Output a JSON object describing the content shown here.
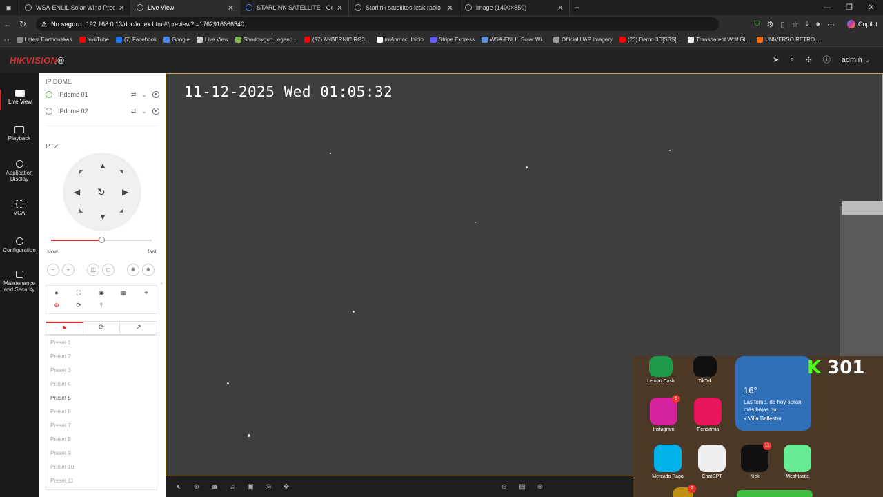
{
  "browser": {
    "tabs": [
      {
        "title": "WSA-ENLIL Solar Wind Predictio",
        "active": false
      },
      {
        "title": "Live View",
        "active": true
      },
      {
        "title": "STARLINK SATELLITE - Google Se",
        "active": false
      },
      {
        "title": "Starlink satellites leak radio signal",
        "active": false
      },
      {
        "title": "image (1400×850)",
        "active": false
      }
    ],
    "security_label": "No seguro",
    "url": "192.168.0.13/doc/index.html#/preview?t=1762916666540",
    "copilot_label": "Copilot",
    "bookmarks": [
      {
        "label": "Latest Earthquakes",
        "color": "#888888"
      },
      {
        "label": "YouTube",
        "color": "#ff0000"
      },
      {
        "label": "(7) Facebook",
        "color": "#1877f2"
      },
      {
        "label": "Google",
        "color": "#4285f4"
      },
      {
        "label": "Live View",
        "color": "#cccccc"
      },
      {
        "label": "Shadowgun Legend...",
        "color": "#7cb342"
      },
      {
        "label": "(97) ANBERNIC RG3...",
        "color": "#ff0000"
      },
      {
        "label": "miAnmac. Inicio",
        "color": "#ffffff"
      },
      {
        "label": "Stripe Express",
        "color": "#635bff"
      },
      {
        "label": "WSA-ENLIL Solar Wi...",
        "color": "#5b8fd6"
      },
      {
        "label": "Official UAP Imagery",
        "color": "#999999"
      },
      {
        "label": "(20) Demo 3D[SBS]...",
        "color": "#ff0000"
      },
      {
        "label": "Transparent Wolf Gl...",
        "color": "#eeeeee"
      },
      {
        "label": "UNIVERSO RETRO...",
        "color": "#ff6a00"
      }
    ]
  },
  "app": {
    "brand": "HIKVISION",
    "brand_mark": "®",
    "user": "admin",
    "accent": "#d62e2e"
  },
  "nav": [
    {
      "label": "Live View",
      "icon": "live-view-icon",
      "active": true
    },
    {
      "label": "Playback",
      "icon": "playback-icon",
      "active": false
    },
    {
      "label": "Application Display",
      "icon": "application-icon",
      "active": false
    },
    {
      "label": "VCA",
      "icon": "vca-icon",
      "active": false
    },
    {
      "label": "Configuration",
      "icon": "gear-icon",
      "active": false
    },
    {
      "label": "Maintenance and Security",
      "icon": "maintenance-icon",
      "active": false
    }
  ],
  "panel": {
    "group_label": "IP DOME",
    "cameras": [
      "IPdome 01",
      "IPdome 02"
    ],
    "ptz_label": "PTZ",
    "speed_slow": "slow",
    "speed_fast": "fast",
    "speed_level": 0.5,
    "presets": [
      "Preset 1",
      "Preset 2",
      "Preset 3",
      "Preset 4",
      "Preset 5",
      "Preset 6",
      "Preset 7",
      "Preset 8",
      "Preset 9",
      "Preset 10",
      "Preset 11"
    ],
    "highlighted_preset": "Preset 5"
  },
  "video": {
    "osd_timestamp": "11-12-2025 Wed 01:05:32"
  },
  "phone_overlay": {
    "apps": [
      {
        "label": "Lemon Cash",
        "color": "#1d9a4a",
        "badge": ""
      },
      {
        "label": "TikTok",
        "color": "#111111",
        "badge": ""
      },
      {
        "label": "Instagram",
        "color": "#d6249f",
        "badge": "6"
      },
      {
        "label": "Tiendamia",
        "color": "#e8155c",
        "badge": ""
      },
      {
        "label": "Mercado Pago",
        "color": "#00b1ea",
        "badge": ""
      },
      {
        "label": "ChatGPT",
        "color": "#eeeeee",
        "badge": ""
      },
      {
        "label": "Kick",
        "color": "#111111",
        "badge": "11"
      },
      {
        "label": "Meshtastic",
        "color": "#67ea94",
        "badge": ""
      }
    ],
    "weather": {
      "temp": "16°",
      "desc": "Las temp. de hoy serán más bajas qu...",
      "location": "Villa Ballester"
    },
    "stream_label": "301",
    "stream_prefix": "K",
    "bottom_badge": "2"
  }
}
